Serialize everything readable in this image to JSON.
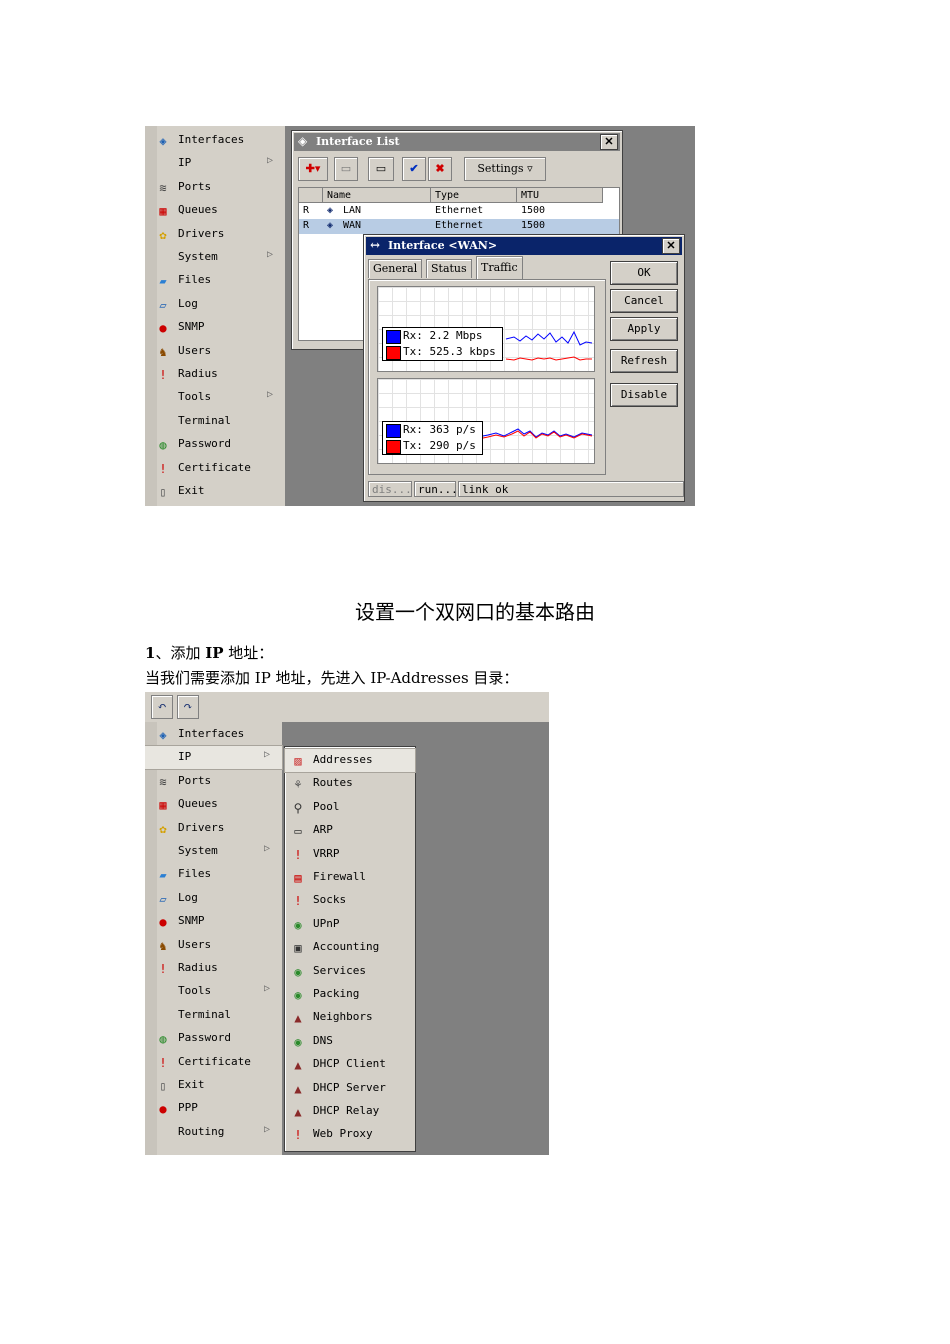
{
  "screenshot1": {
    "menu_items": [
      {
        "icon": "interfaces-icon",
        "glyph": "◈",
        "label": "Interfaces",
        "submenu": false
      },
      {
        "icon": "",
        "glyph": "",
        "label": "IP",
        "submenu": true
      },
      {
        "icon": "ports-icon",
        "glyph": "≋",
        "label": "Ports",
        "submenu": false
      },
      {
        "icon": "queues-icon",
        "glyph": "▦",
        "label": "Queues",
        "submenu": false
      },
      {
        "icon": "drivers-icon",
        "glyph": "✿",
        "label": "Drivers",
        "submenu": false
      },
      {
        "icon": "",
        "glyph": "",
        "label": "System",
        "submenu": true
      },
      {
        "icon": "files-icon",
        "glyph": "▰",
        "label": "Files",
        "submenu": false
      },
      {
        "icon": "log-icon",
        "glyph": "▱",
        "label": "Log",
        "submenu": false
      },
      {
        "icon": "snmp-icon",
        "glyph": "●",
        "label": "SNMP",
        "submenu": false
      },
      {
        "icon": "users-icon",
        "glyph": "♞",
        "label": "Users",
        "submenu": false
      },
      {
        "icon": "radius-icon",
        "glyph": "!",
        "label": "Radius",
        "submenu": false
      },
      {
        "icon": "",
        "glyph": "",
        "label": "Tools",
        "submenu": true
      },
      {
        "icon": "",
        "glyph": "",
        "label": "Terminal",
        "submenu": false
      },
      {
        "icon": "password-icon",
        "glyph": "◍",
        "label": "Password",
        "submenu": false
      },
      {
        "icon": "certificate-icon",
        "glyph": "!",
        "label": "Certificate",
        "submenu": false
      },
      {
        "icon": "exit-icon",
        "glyph": "▯",
        "label": "Exit",
        "submenu": false
      }
    ],
    "interface_list": {
      "title": "Interface List",
      "settings_label": "Settings",
      "columns": [
        "Name",
        "Type",
        "MTU"
      ],
      "rows": [
        {
          "flag": "R",
          "name": "LAN",
          "type": "Ethernet",
          "mtu": "1500"
        },
        {
          "flag": "R",
          "name": "WAN",
          "type": "Ethernet",
          "mtu": "1500"
        }
      ]
    },
    "interface_window": {
      "title": "Interface <WAN>",
      "tabs": [
        "General",
        "Status",
        "Traffic"
      ],
      "active_tab": "Traffic",
      "buttons": [
        "OK",
        "Cancel",
        "Apply",
        "Refresh",
        "Disable"
      ],
      "graph1": {
        "rx": "Rx: 2.2 Mbps",
        "tx": "Tx: 525.3 kbps"
      },
      "graph2": {
        "rx": "Rx: 363 p/s",
        "tx": "Tx: 290 p/s"
      },
      "status": [
        "dis...",
        "run...",
        "link ok"
      ],
      "colors": {
        "rx": "#0000ff",
        "tx": "#ff0000",
        "title": "#0a246a"
      }
    }
  },
  "heading": "设置一个双网口的基本路由",
  "step1": {
    "num": "1",
    "sep": "、添加 ",
    "bold": "IP",
    "rest": " 地址："
  },
  "paragraph": "当我们需要添加 IP 地址，先进入 IP-Addresses 目录：",
  "screenshot2": {
    "menu_items": [
      {
        "icon": "interfaces-icon",
        "glyph": "◈",
        "label": "Interfaces",
        "submenu": false
      },
      {
        "icon": "",
        "glyph": "",
        "label": "IP",
        "submenu": true
      },
      {
        "icon": "ports-icon",
        "glyph": "≋",
        "label": "Ports",
        "submenu": false
      },
      {
        "icon": "queues-icon",
        "glyph": "▦",
        "label": "Queues",
        "submenu": false
      },
      {
        "icon": "drivers-icon",
        "glyph": "✿",
        "label": "Drivers",
        "submenu": false
      },
      {
        "icon": "",
        "glyph": "",
        "label": "System",
        "submenu": true
      },
      {
        "icon": "files-icon",
        "glyph": "▰",
        "label": "Files",
        "submenu": false
      },
      {
        "icon": "log-icon",
        "glyph": "▱",
        "label": "Log",
        "submenu": false
      },
      {
        "icon": "snmp-icon",
        "glyph": "●",
        "label": "SNMP",
        "submenu": false
      },
      {
        "icon": "users-icon",
        "glyph": "♞",
        "label": "Users",
        "submenu": false
      },
      {
        "icon": "radius-icon",
        "glyph": "!",
        "label": "Radius",
        "submenu": false
      },
      {
        "icon": "",
        "glyph": "",
        "label": "Tools",
        "submenu": true
      },
      {
        "icon": "",
        "glyph": "",
        "label": "Terminal",
        "submenu": false
      },
      {
        "icon": "password-icon",
        "glyph": "◍",
        "label": "Password",
        "submenu": false
      },
      {
        "icon": "certificate-icon",
        "glyph": "!",
        "label": "Certificate",
        "submenu": false
      },
      {
        "icon": "exit-icon",
        "glyph": "▯",
        "label": "Exit",
        "submenu": false
      },
      {
        "icon": "ppp-icon",
        "glyph": "●",
        "label": "PPP",
        "submenu": false
      },
      {
        "icon": "",
        "glyph": "",
        "label": "Routing",
        "submenu": true
      }
    ],
    "ip_submenu": [
      {
        "icon": "addresses-icon",
        "glyph": "▨",
        "label": "Addresses"
      },
      {
        "icon": "routes-icon",
        "glyph": "⚘",
        "label": "Routes"
      },
      {
        "icon": "pool-icon",
        "glyph": "⚲",
        "label": "Pool"
      },
      {
        "icon": "arp-icon",
        "glyph": "▭",
        "label": "ARP"
      },
      {
        "icon": "vrrp-icon",
        "glyph": "!",
        "label": "VRRP"
      },
      {
        "icon": "firewall-icon",
        "glyph": "▤",
        "label": "Firewall"
      },
      {
        "icon": "socks-icon",
        "glyph": "!",
        "label": "Socks"
      },
      {
        "icon": "upnp-icon",
        "glyph": "◉",
        "label": "UPnP"
      },
      {
        "icon": "accounting-icon",
        "glyph": "▣",
        "label": "Accounting"
      },
      {
        "icon": "services-icon",
        "glyph": "◉",
        "label": "Services"
      },
      {
        "icon": "packing-icon",
        "glyph": "◉",
        "label": "Packing"
      },
      {
        "icon": "neighbors-icon",
        "glyph": "▲",
        "label": "Neighbors"
      },
      {
        "icon": "dns-icon",
        "glyph": "◉",
        "label": "DNS"
      },
      {
        "icon": "dhcp-client-icon",
        "glyph": "▲",
        "label": "DHCP Client"
      },
      {
        "icon": "dhcp-server-icon",
        "glyph": "▲",
        "label": "DHCP Server"
      },
      {
        "icon": "dhcp-relay-icon",
        "glyph": "▲",
        "label": "DHCP Relay"
      },
      {
        "icon": "web-proxy-icon",
        "glyph": "!",
        "label": "Web Proxy"
      }
    ]
  }
}
